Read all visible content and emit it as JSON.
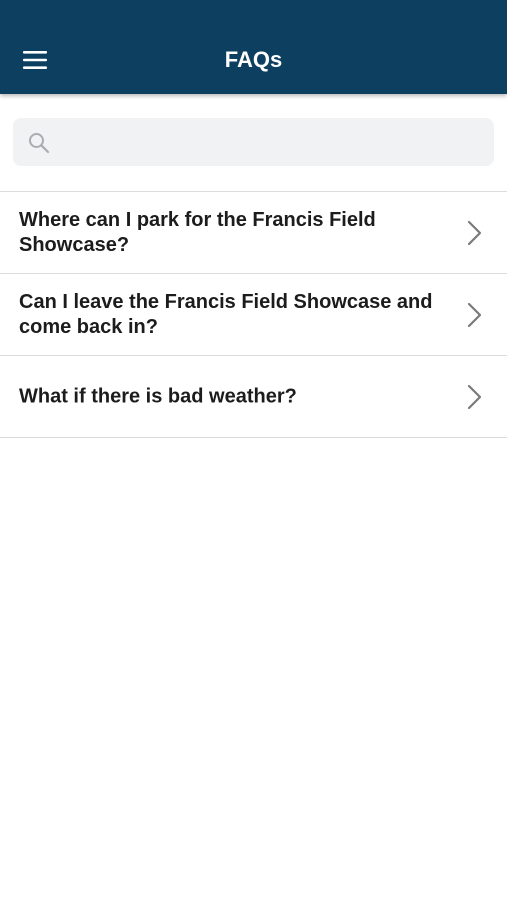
{
  "header": {
    "title": "FAQs",
    "menu_icon": "hamburger-menu-icon"
  },
  "search": {
    "placeholder": "",
    "value": "",
    "icon": "search-icon"
  },
  "faqs": [
    {
      "question": "Where can I park for the Francis Field Showcase?"
    },
    {
      "question": "Can I leave the Francis Field Showcase and come back in?"
    },
    {
      "question": "What if there is bad weather?"
    }
  ],
  "colors": {
    "header_bg": "#0c3f60",
    "search_bg": "#f1f2f3",
    "divider": "#dcdcdc",
    "chevron": "#7a7a7a"
  }
}
